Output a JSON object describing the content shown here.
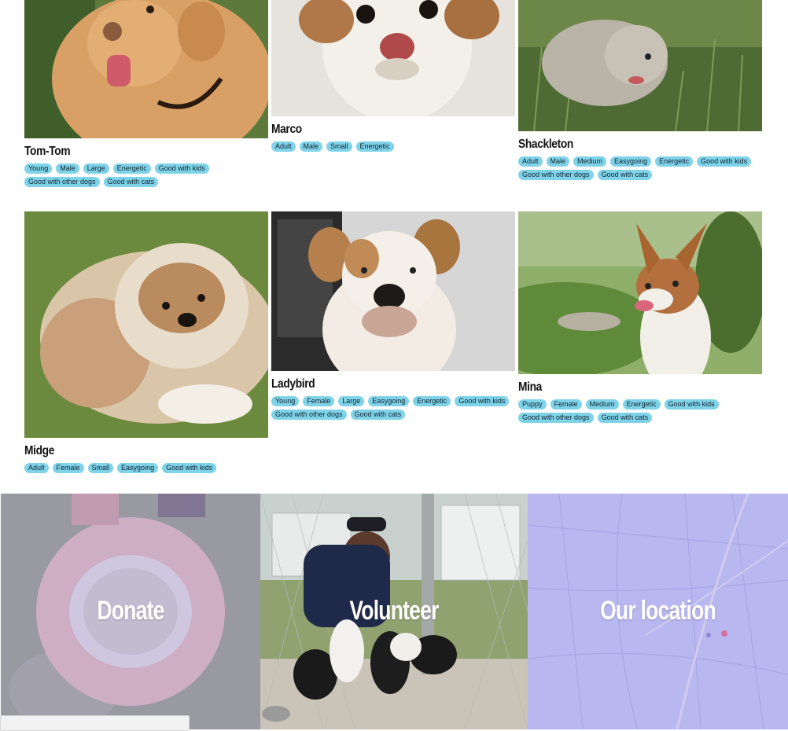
{
  "dogs": [
    {
      "name": "Tom-Tom",
      "tags": [
        "Young",
        "Male",
        "Large",
        "Energetic",
        "Good with kids",
        "Good with other dogs",
        "Good with cats"
      ]
    },
    {
      "name": "Marco",
      "tags": [
        "Adult",
        "Male",
        "Small",
        "Energetic"
      ]
    },
    {
      "name": "Shackleton",
      "tags": [
        "Adult",
        "Male",
        "Medium",
        "Easygoing",
        "Energetic",
        "Good with kids",
        "Good with other dogs",
        "Good with cats"
      ]
    },
    {
      "name": "Midge",
      "tags": [
        "Adult",
        "Female",
        "Small",
        "Easygoing",
        "Good with kids"
      ]
    },
    {
      "name": "Ladybird",
      "tags": [
        "Young",
        "Female",
        "Large",
        "Easygoing",
        "Energetic",
        "Good with kids",
        "Good with other dogs",
        "Good with cats"
      ]
    },
    {
      "name": "Mina",
      "tags": [
        "Puppy",
        "Female",
        "Medium",
        "Energetic",
        "Good with kids",
        "Good with other dogs",
        "Good with cats"
      ]
    }
  ],
  "panels": {
    "donate": "Donate",
    "volunteer": "Volunteer",
    "location": "Our location"
  },
  "colors": {
    "tag_bg": "#7fd3e8",
    "donate_overlay": "#b9a6dc",
    "map_overlay": "#b8b6ee"
  }
}
